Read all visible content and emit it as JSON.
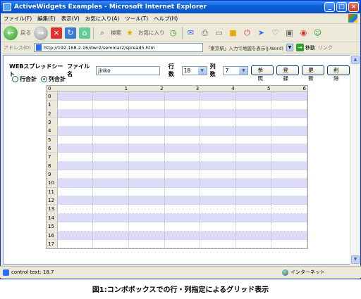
{
  "window": {
    "title": "ActiveWidgets Examples - Microsoft Internet Explorer"
  },
  "menu": [
    "ファイル(F)",
    "編集(E)",
    "表示(V)",
    "お気に入り(A)",
    "ツール(T)",
    "ヘルプ(H)"
  ],
  "toolbar": {
    "back": "戻る",
    "search": "検索",
    "favorites": "お気に入り"
  },
  "address": {
    "label": "アドレス(D)",
    "url": "http://192.168.2.16/dwr2/seminar2/spread5.htm",
    "hint": "「東京駅」入力で地図を表示(J-Word)",
    "go": "移動",
    "links": "リンク"
  },
  "form": {
    "title": "WEBスプレッドシート",
    "filename_label": "ファイル名",
    "filename_value": "jinko",
    "rows_label": "行数",
    "rows_value": "18",
    "cols_label": "列数",
    "cols_value": "7",
    "buttons": [
      "参照",
      "登録",
      "更新",
      "削除"
    ],
    "radio_row_total": "行合計",
    "radio_col_total": "列合計"
  },
  "grid": {
    "columns": [
      "0",
      "1",
      "2",
      "3",
      "4",
      "5",
      "6"
    ],
    "rows": [
      "0",
      "1",
      "2",
      "3",
      "4",
      "5",
      "6",
      "7",
      "8",
      "9",
      "10",
      "11",
      "12",
      "13",
      "14",
      "15",
      "16",
      "17"
    ]
  },
  "status": {
    "text": "control text: 18.7",
    "zone": "インターネット"
  },
  "caption": "図1:コンボボックスでの行・列指定によるグリッド表示"
}
